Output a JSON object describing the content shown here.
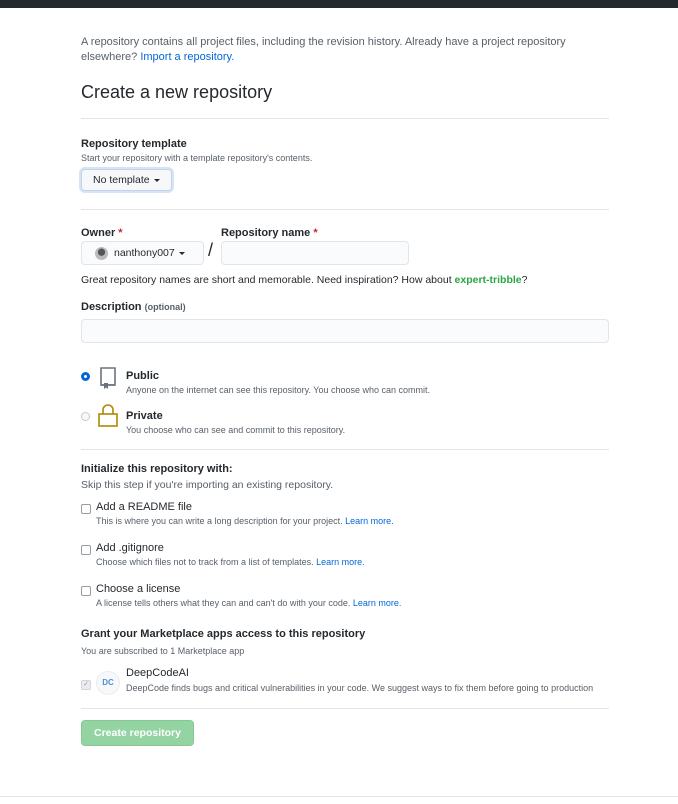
{
  "intro": {
    "text": "A repository contains all project files, including the revision history. Already have a project repository elsewhere? ",
    "import_link": "Import a repository."
  },
  "page_title": "Create a new repository",
  "template": {
    "label": "Repository template",
    "note": "Start your repository with a template repository's contents.",
    "selected": "No template"
  },
  "owner": {
    "label": "Owner",
    "required_mark": "*",
    "value": "nanthony007"
  },
  "repo_name": {
    "label": "Repository name",
    "required_mark": "*",
    "value": "",
    "separator": "/"
  },
  "suggestion": {
    "text": "Great repository names are short and memorable. Need inspiration? How about ",
    "name": "expert-tribble",
    "end": "?"
  },
  "description": {
    "label": "Description",
    "optional": "(optional)",
    "value": ""
  },
  "visibility": {
    "selected": "public",
    "public": {
      "title": "Public",
      "desc": "Anyone on the internet can see this repository. You choose who can commit."
    },
    "private": {
      "title": "Private",
      "desc": "You choose who can see and commit to this repository."
    }
  },
  "initialize": {
    "title": "Initialize this repository with:",
    "note": "Skip this step if you're importing an existing repository.",
    "options": [
      {
        "title": "Add a README file",
        "desc": "This is where you can write a long description for your project. ",
        "link": "Learn more.",
        "checked": false
      },
      {
        "title": "Add .gitignore",
        "desc": "Choose which files not to track from a list of templates. ",
        "link": "Learn more.",
        "checked": false
      },
      {
        "title": "Choose a license",
        "desc": "A license tells others what they can and can't do with your code. ",
        "link": "Learn more.",
        "checked": false
      }
    ]
  },
  "marketplace": {
    "title": "Grant your Marketplace apps access to this repository",
    "note": "You are subscribed to 1 Marketplace app",
    "app": {
      "name": "DeepCodeAI",
      "logo_text": "DC",
      "desc": "DeepCode finds bugs and critical vulnerabilities in your code. We suggest ways to fix them before going to production",
      "checked": true
    }
  },
  "create_button": "Create repository",
  "colors": {
    "link": "#0366d6",
    "suggestion": "#28a745",
    "required": "#cb2431",
    "create_button_disabled": "#94d3a2"
  }
}
